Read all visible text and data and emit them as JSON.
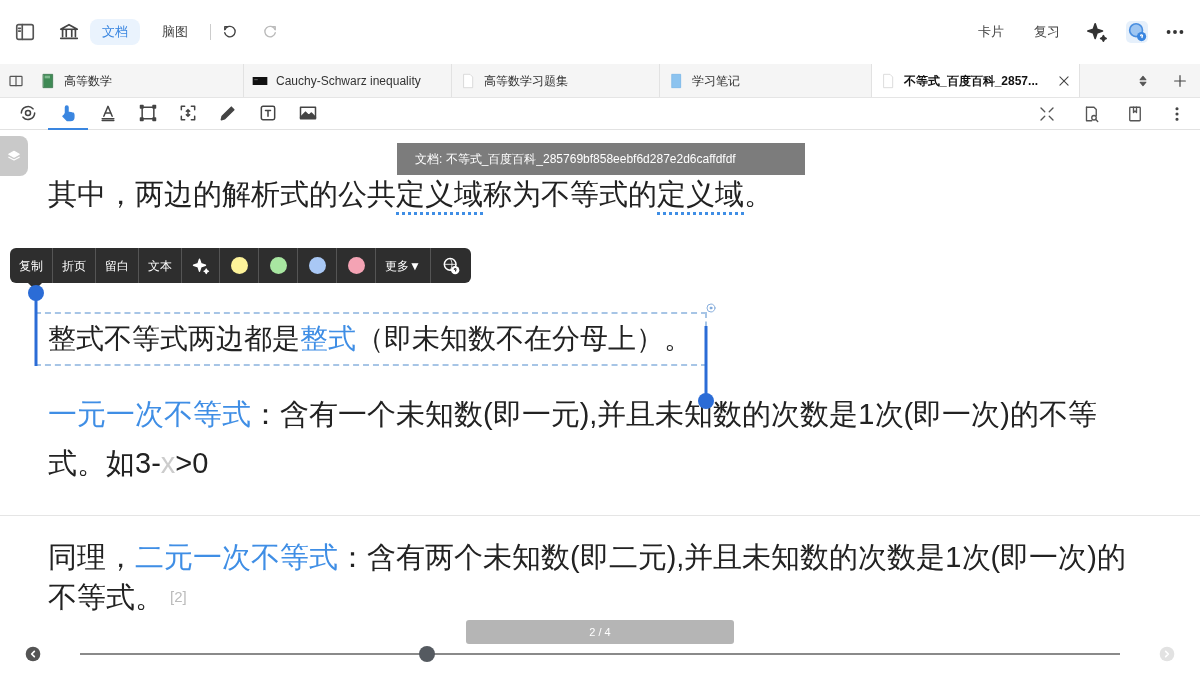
{
  "top_bar": {
    "view_tabs": [
      {
        "label": "文档",
        "selected": true
      },
      {
        "label": "脑图",
        "selected": false
      }
    ],
    "right_links": [
      "卡片",
      "复习"
    ]
  },
  "tabs": [
    {
      "label": "高等数学",
      "kind": "book",
      "selected": false
    },
    {
      "label": "Cauchy-Schwarz inequality",
      "kind": "terminal",
      "selected": false
    },
    {
      "label": "高等数学习题集",
      "kind": "document",
      "selected": false
    },
    {
      "label": "学习笔记",
      "kind": "notebook",
      "selected": false
    },
    {
      "label": "不等式_百度百科_2857...",
      "kind": "document",
      "selected": true
    }
  ],
  "tools": [
    {
      "kind": "rotate",
      "selected": false
    },
    {
      "kind": "hand",
      "selected": true
    },
    {
      "kind": "text-style",
      "selected": false
    },
    {
      "kind": "rect",
      "selected": false
    },
    {
      "kind": "resize",
      "selected": false
    },
    {
      "kind": "pen",
      "selected": false
    },
    {
      "kind": "textbox",
      "selected": false
    },
    {
      "kind": "image",
      "selected": false
    }
  ],
  "tooltip": "文档: 不等式_百度百科_285769bf858eebf6d287e2d6caffdfdf",
  "paragraphs": [
    {
      "segments": [
        {
          "kind": "plain",
          "text": "其中，两边的解析式的公共"
        },
        {
          "kind": "dotted",
          "text": "定义域"
        },
        {
          "kind": "plain",
          "text": "称为不等式的"
        },
        {
          "kind": "dotted",
          "text": "定义域"
        },
        {
          "kind": "plain",
          "text": "。"
        }
      ]
    },
    {
      "selected": true,
      "segments": [
        {
          "kind": "plain",
          "text": "整式不等式两边都是"
        },
        {
          "kind": "link",
          "text": "整式"
        },
        {
          "kind": "plain",
          "text": "（即未知数不在分母上）。"
        }
      ]
    },
    {
      "segments": [
        {
          "kind": "link",
          "text": "一元一次不等式"
        },
        {
          "kind": "plain",
          "text": "：含有一个未知数(即一元),并且未知数的次数是1次(即一次)的不等式。如3-"
        },
        {
          "kind": "faint",
          "text": "x"
        },
        {
          "kind": "plain",
          "text": ">0"
        }
      ]
    },
    {
      "divider": true,
      "segments": [
        {
          "kind": "plain",
          "text": "同理，"
        },
        {
          "kind": "link",
          "text": "二元一次不等式"
        },
        {
          "kind": "plain",
          "text": "：含有两个未知数(即二元),并且未知数的次数是1次(即一次)的不等式。"
        },
        {
          "kind": "ref",
          "text": "[2]"
        }
      ]
    }
  ],
  "float_toolbar": {
    "actions": [
      "复制",
      "折页",
      "留白",
      "文本"
    ],
    "colors": [
      {
        "color": "#fdf39a"
      },
      {
        "color": "#a8e6a1"
      },
      {
        "color": "#a9c8f5"
      },
      {
        "color": "#f4a3b4"
      }
    ],
    "more": "更多▼"
  },
  "page_indicator": "2 / 4",
  "slider": {
    "level": 0.334
  }
}
